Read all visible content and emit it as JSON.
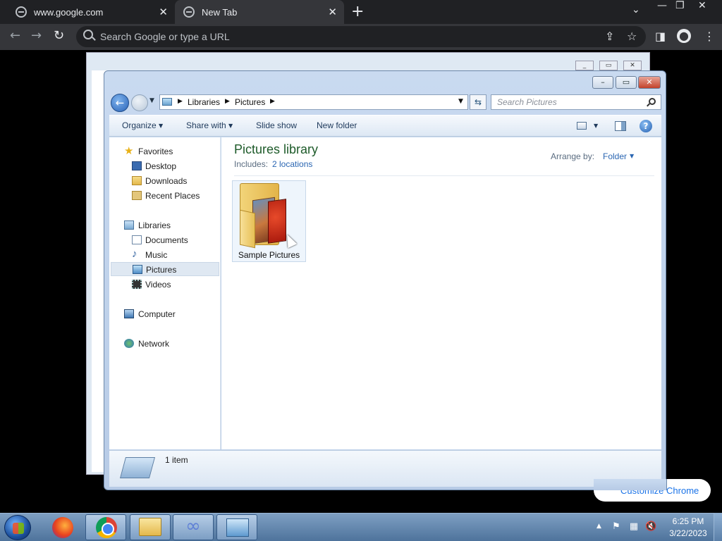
{
  "browser": {
    "tabs": [
      {
        "label": "www.google.com"
      },
      {
        "label": "New Tab"
      }
    ],
    "omnibox_placeholder": "Search Google or type a URL",
    "customize_label": "Customize Chrome"
  },
  "explorer": {
    "breadcrumb": [
      "Libraries",
      "Pictures"
    ],
    "search_placeholder": "Search Pictures",
    "commands": {
      "organize": "Organize",
      "share_with": "Share with",
      "slide_show": "Slide show",
      "new_folder": "New folder"
    },
    "nav": {
      "favorites": "Favorites",
      "desktop": "Desktop",
      "downloads": "Downloads",
      "recent_places": "Recent Places",
      "libraries": "Libraries",
      "documents": "Documents",
      "music": "Music",
      "pictures": "Pictures",
      "videos": "Videos",
      "computer": "Computer",
      "network": "Network"
    },
    "library_title": "Pictures library",
    "includes_label": "Includes:",
    "includes_value": "2 locations",
    "arrange_label": "Arrange by:",
    "arrange_value": "Folder",
    "items": [
      {
        "name": "Sample Pictures"
      }
    ],
    "status_text": "1 item"
  },
  "taskbar": {
    "clock_time": "6:25 PM",
    "clock_date": "3/22/2023"
  }
}
